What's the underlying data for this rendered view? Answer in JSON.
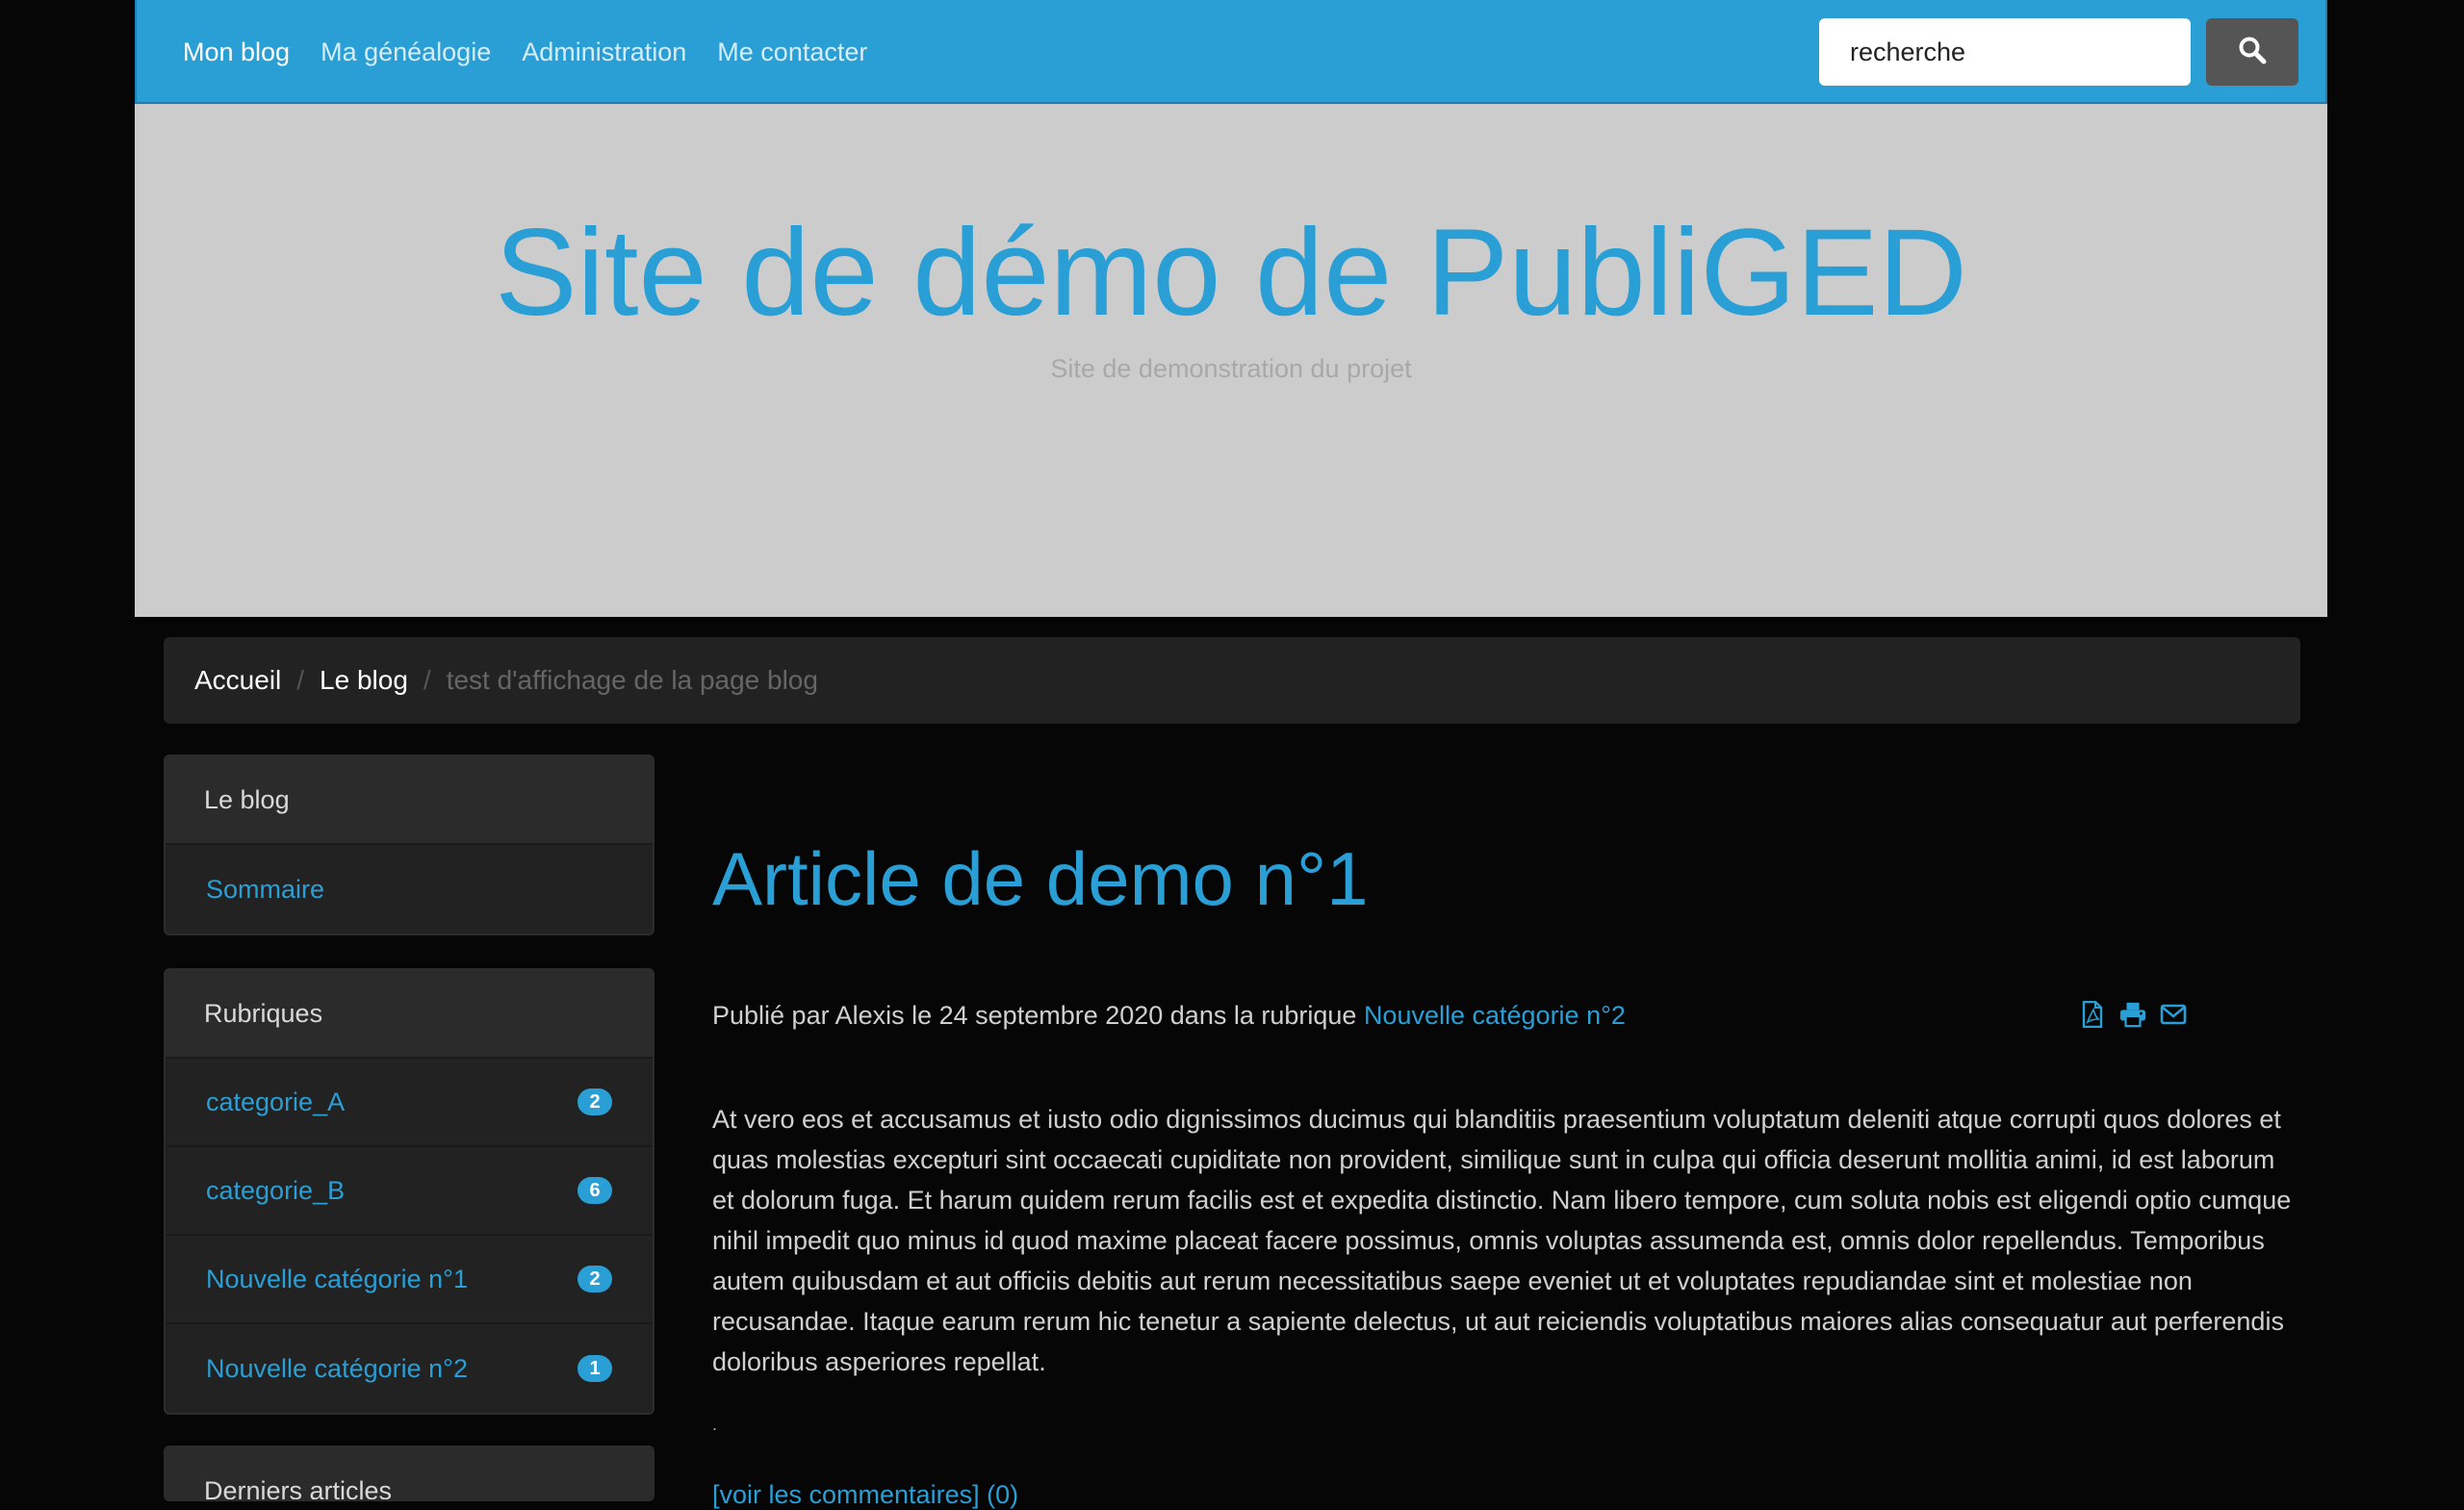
{
  "nav": {
    "items": [
      "Mon blog",
      "Ma généalogie",
      "Administration",
      "Me contacter"
    ],
    "search_placeholder": "recherche"
  },
  "banner": {
    "title": "Site de démo de PubliGED",
    "subtitle": "Site de demonstration du projet"
  },
  "breadcrumb": {
    "items": [
      "Accueil",
      "Le blog"
    ],
    "current": "test d'affichage de la page blog"
  },
  "sidebar": {
    "blog_panel": {
      "heading": "Le blog",
      "items": [
        "Sommaire"
      ]
    },
    "rubriques_panel": {
      "heading": "Rubriques",
      "items": [
        {
          "label": "categorie_A",
          "count": "2"
        },
        {
          "label": "categorie_B",
          "count": "6"
        },
        {
          "label": "Nouvelle catégorie n°1",
          "count": "2"
        },
        {
          "label": "Nouvelle catégorie n°2",
          "count": "1"
        }
      ]
    },
    "latest_panel": {
      "heading": "Derniers articles"
    }
  },
  "article": {
    "title": "Article de demo n°1",
    "meta_prefix": "Publié par Alexis le 24 septembre 2020 dans la rubrique ",
    "meta_category": "Nouvelle catégorie n°2",
    "body": "At vero eos et accusamus et iusto odio dignissimos ducimus qui blanditiis praesentium voluptatum deleniti atque corrupti quos dolores et quas molestias excepturi sint occaecati cupiditate non provident, similique sunt in culpa qui officia deserunt mollitia animi, id est laborum et dolorum fuga. Et harum quidem rerum facilis est et expedita distinctio. Nam libero tempore, cum soluta nobis est eligendi optio cumque nihil impedit quo minus id quod maxime placeat facere possimus, omnis voluptas assumenda est, omnis dolor repellendus. Temporibus autem quibusdam et aut officiis debitis aut rerum necessitatibus saepe eveniet ut et voluptates repudiandae sint et molestiae non recusandae. Itaque earum rerum hic tenetur a sapiente delectus, ut aut reiciendis voluptatibus maiores alias consequatur aut perferendis doloribus asperiores repellat.",
    "separator": ".",
    "comments_link": "[voir les commentaires] (0)"
  },
  "colors": {
    "accent": "#2a9fd6",
    "navbar": "#2a9fd6",
    "banner": "#cccccc",
    "panel": "#222222",
    "background": "#060606"
  },
  "icons": [
    "search-icon",
    "pdf-icon",
    "print-icon",
    "envelope-icon"
  ]
}
